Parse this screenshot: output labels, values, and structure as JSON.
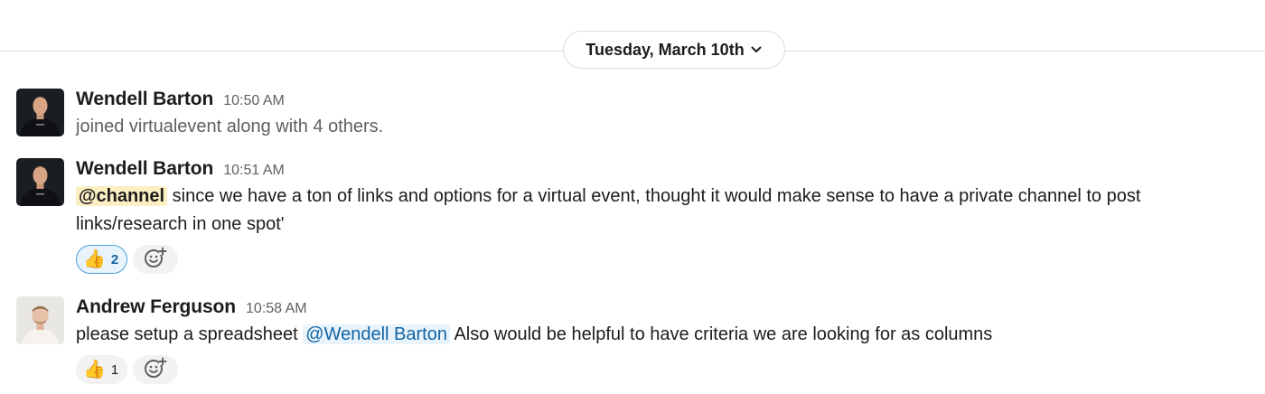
{
  "date_divider": {
    "label": "Tuesday, March 10th",
    "icon": "chevron-down-icon"
  },
  "messages": [
    {
      "author": "Wendell Barton",
      "time": "10:50 AM",
      "text": "joined virtualevent along with 4 others.",
      "muted": true
    },
    {
      "author": "Wendell Barton",
      "time": "10:51 AM",
      "mention": "@channel",
      "text": "since we have a ton of links and options for a virtual event, thought it would make sense to have a private channel to post links/research in one spot'",
      "reactions": [
        {
          "emoji": "👍",
          "count": "2",
          "mine": true
        }
      ]
    },
    {
      "author": "Andrew Ferguson",
      "time": "10:58 AM",
      "text_before": "please setup a spreadsheet",
      "mention": "@Wendell Barton",
      "text_after": "Also would be helpful to have criteria we are looking for as columns",
      "reactions": [
        {
          "emoji": "👍",
          "count": "1",
          "mine": false
        }
      ]
    }
  ],
  "colors": {
    "mention_channel_bg": "#fcefc4",
    "mention_user_bg": "#e8f3fb",
    "mention_user_text": "#1264a3",
    "reaction_active_border": "#4a9fd8"
  }
}
